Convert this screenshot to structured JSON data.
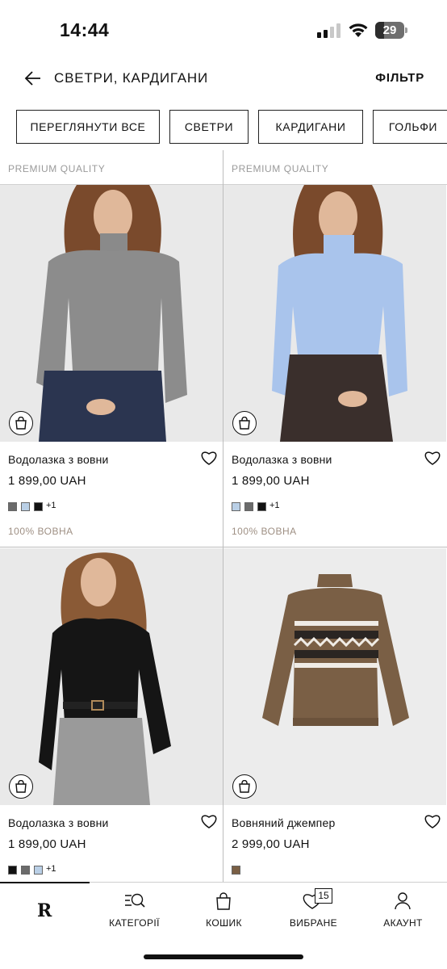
{
  "status_bar": {
    "time": "14:44",
    "battery": "29"
  },
  "header": {
    "title": "СВЕТРИ, КАРДИГАНИ",
    "filter_label": "ФІЛЬТР"
  },
  "chips": [
    "ПЕРЕГЛЯНУТИ ВСЕ",
    "СВЕТРИ",
    "КАРДИГАНИ",
    "ГОЛЬФИ"
  ],
  "cut_row_label": "PREMIUM QUALITY",
  "products": [
    {
      "name": "Водолазка з вовни",
      "price": "1 899,00 UAH",
      "swatches": [
        "#6b6b6b",
        "#b9cfe6",
        "#111111"
      ],
      "more": "+1",
      "material": "100% ВОВНА",
      "image": "grey-turtleneck"
    },
    {
      "name": "Водолазка з вовни",
      "price": "1 899,00 UAH",
      "swatches": [
        "#b9cfe6",
        "#6b6b6b",
        "#111111"
      ],
      "more": "+1",
      "material": "100% ВОВНА",
      "image": "blue-turtleneck"
    },
    {
      "name": "Водолазка з вовни",
      "price": "1 899,00 UAH",
      "swatches": [
        "#111111",
        "#6b6b6b",
        "#b9cfe6"
      ],
      "more": "+1",
      "material": "",
      "image": "black-turtleneck"
    },
    {
      "name": "Вовняний джемпер",
      "price": "2 999,00 UAH",
      "swatches": [
        "#7a5f45"
      ],
      "more": "",
      "material": "",
      "image": "brown-fairisle-jumper"
    }
  ],
  "tabbar": {
    "logo": "R",
    "categories": "КАТЕГОРІЇ",
    "cart": "КОШИК",
    "wishlist": "ВИБРАНЕ",
    "wishlist_count": "15",
    "account": "АКАУНТ"
  }
}
